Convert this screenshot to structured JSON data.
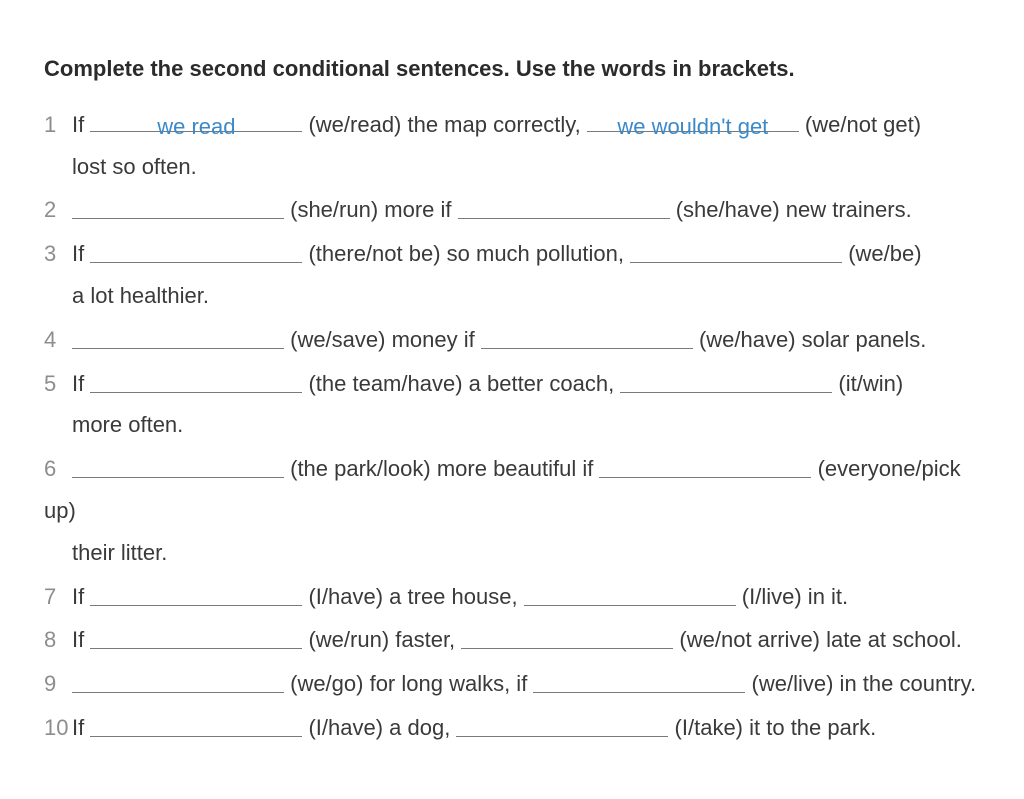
{
  "title": "Complete the second conditional sentences. Use the words in brackets.",
  "items": [
    {
      "num": "1",
      "pre": "If ",
      "blank1": "we read",
      "hint1": " (we/read) the map correctly, ",
      "blank2": "we wouldn't get",
      "hint2": " (we/not get)",
      "cont": "lost so often."
    },
    {
      "num": "2",
      "pre": "",
      "blank1": "",
      "hint1": " (she/run) more if ",
      "blank2": "",
      "hint2": " (she/have) new trainers.",
      "cont": ""
    },
    {
      "num": "3",
      "pre": "If ",
      "blank1": "",
      "hint1": " (there/not be) so much pollution, ",
      "blank2": "",
      "hint2": " (we/be)",
      "cont": "a lot healthier."
    },
    {
      "num": "4",
      "pre": "",
      "blank1": "",
      "hint1": " (we/save) money if ",
      "blank2": "",
      "hint2": " (we/have) solar panels.",
      "cont": ""
    },
    {
      "num": "5",
      "pre": "If ",
      "blank1": "",
      "hint1": " (the team/have) a better coach, ",
      "blank2": "",
      "hint2": " (it/win)",
      "cont": "more often."
    },
    {
      "num": "6",
      "pre": "",
      "blank1": "",
      "hint1": " (the park/look) more beautiful if ",
      "blank2": "",
      "hint2": " (everyone/pick up)",
      "cont": "their litter."
    },
    {
      "num": "7",
      "pre": "If ",
      "blank1": "",
      "hint1": " (I/have) a tree house, ",
      "blank2": "",
      "hint2": " (I/live) in it.",
      "cont": ""
    },
    {
      "num": "8",
      "pre": "If ",
      "blank1": "",
      "hint1": " (we/run) faster, ",
      "blank2": "",
      "hint2": " (we/not arrive) late at school.",
      "cont": ""
    },
    {
      "num": "9",
      "pre": "",
      "blank1": "",
      "hint1": " (we/go) for long walks, if ",
      "blank2": "",
      "hint2": " (we/live) in the country.",
      "cont": ""
    },
    {
      "num": "10",
      "pre": "If ",
      "blank1": "",
      "hint1": " (I/have) a dog, ",
      "blank2": "",
      "hint2": " (I/take) it to the park.",
      "cont": ""
    }
  ]
}
